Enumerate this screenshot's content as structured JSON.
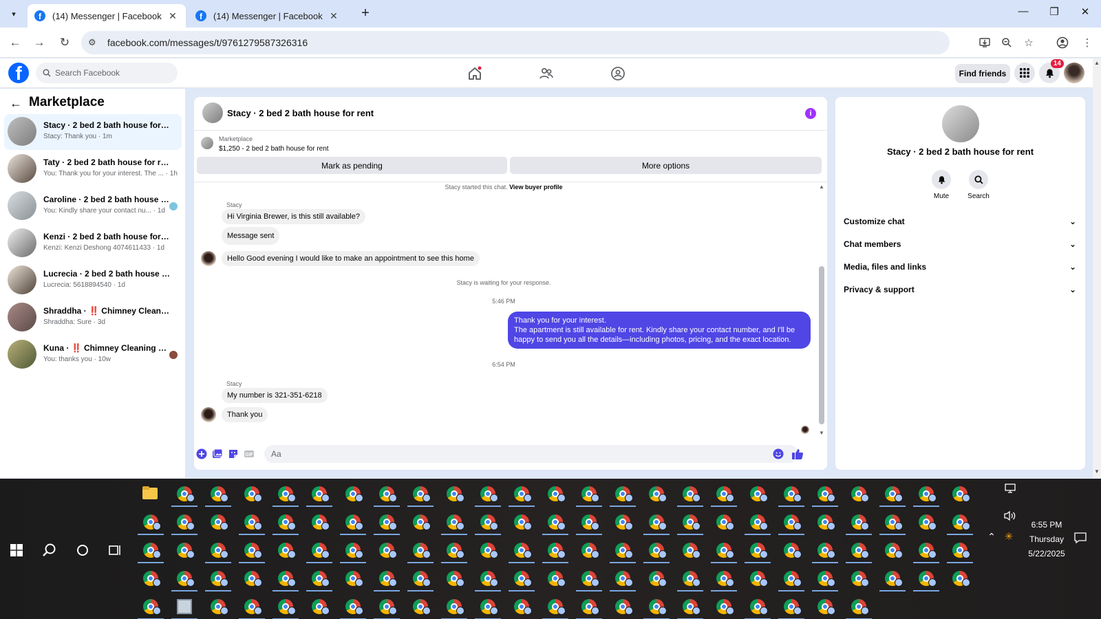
{
  "browser": {
    "tabs": [
      {
        "title": "(14) Messenger | Facebook",
        "active": true
      },
      {
        "title": "(14) Messenger | Facebook",
        "active": false
      }
    ],
    "url": "facebook.com/messages/t/9761279587326316"
  },
  "fb": {
    "search_placeholder": "Search Facebook",
    "find_friends": "Find friends",
    "notification_count": "14"
  },
  "sidebar": {
    "title": "Marketplace",
    "conversations": [
      {
        "name": "Stacy · 2 bed 2 bath house for rent",
        "preview": "Stacy: Thank you · 1m"
      },
      {
        "name": "Taty · 2 bed 2 bath house for rent",
        "preview": "You: Thank you for your interest. The ...  · 1h"
      },
      {
        "name": "Caroline · 2 bed 2 bath house fo...",
        "preview": "You: Kindly share your contact nu... · 1d"
      },
      {
        "name": "Kenzi · 2 bed 2 bath house for rent",
        "preview": "Kenzi: Kenzi Deshong 4074611433 · 1d"
      },
      {
        "name": "Lucrecia · 2 bed 2 bath house for r...",
        "preview": "Lucrecia: 5618894540 · 1d"
      },
      {
        "name": "Shraddha · ‼️ Chimney Cleaning s...",
        "preview": "Shraddha: Sure · 3d"
      },
      {
        "name": "Kuna · ‼️ Chimney Cleaning ser...",
        "preview": "You: thanks you · 10w"
      }
    ]
  },
  "chat": {
    "title": "Stacy · 2 bed 2 bath house for rent",
    "listing_source": "Marketplace",
    "listing_price": "$1,250 - 2 bed 2 bath house for rent",
    "mark_pending": "Mark as pending",
    "more_options": "More options",
    "started_text": "Stacy started this chat.",
    "view_profile": "View buyer profile",
    "sender_1": "Stacy",
    "msg_1": "Hi Virginia Brewer, is this still available?",
    "msg_2": "Message sent",
    "msg_3": "Hello Good evening I would like to make an appointment to see this home",
    "waiting": "Stacy is waiting for your response.",
    "time_1": "5:46 PM",
    "out_line1": "Thank you for your interest.",
    "out_line2": "The apartment is still available for rent. Kindly share your contact number, and I'll be",
    "out_line3": "happy to send you all the details—including photos, pricing, and the exact location.",
    "time_2": "6:54 PM",
    "sender_2": "Stacy",
    "msg_4": "My number is 321-351-6218",
    "msg_5": "Thank you",
    "composer_placeholder": "Aa"
  },
  "details": {
    "title": "Stacy · 2 bed 2 bath house for rent",
    "mute": "Mute",
    "search": "Search",
    "sections": [
      "Customize chat",
      "Chat members",
      "Media, files and links",
      "Privacy & support"
    ]
  },
  "taskbar": {
    "time": "6:55 PM",
    "day": "Thursday",
    "date": "5/22/2025"
  },
  "colors": {
    "fb_blue": "#0866ff",
    "outgoing_bubble": "#4f46e5",
    "info_purple": "#a033ff",
    "active_convo": "#ebf5ff"
  }
}
